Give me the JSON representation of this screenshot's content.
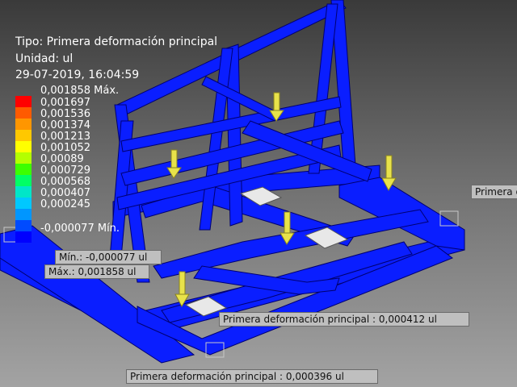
{
  "result": {
    "type_label": "Tipo: Primera deformación principal",
    "unit_label": "Unidad: ul",
    "timestamp": "29-07-2019, 16:04:59"
  },
  "legend": {
    "max_value": "0,001858 Máx.",
    "min_value": "-0,000077 Mín.",
    "values": [
      "0,001697",
      "0,001536",
      "0,001374",
      "0,001213",
      "0,001052",
      "0,00089",
      "0,000729",
      "0,000568",
      "0,000407",
      "0,000245"
    ],
    "colors": [
      "#ff0000",
      "#ff5a00",
      "#ff9600",
      "#ffc800",
      "#ffff00",
      "#b4ff00",
      "#3cff00",
      "#00ff64",
      "#00e6c8",
      "#00c8ff",
      "#0096ff",
      "#004bff",
      "#0000ff"
    ]
  },
  "probes": {
    "min": "Mín.: -0,000077 ul",
    "max": "Máx.: 0,001858 ul",
    "p1": "Primera deformación principal : 0,000412 ul",
    "p2": "Primera deformación principal : 0,000396 ul",
    "p3": "Primera deformación principal"
  },
  "colors": {
    "frame": "#0a1eff",
    "frame_dark": "#0010a0",
    "load_arrow": "#e8e24a",
    "background_top": "#3a3a3a",
    "background_bottom": "#a3a3a3"
  },
  "icons": [
    "load-arrow-icon",
    "fixed-constraint-icon"
  ]
}
